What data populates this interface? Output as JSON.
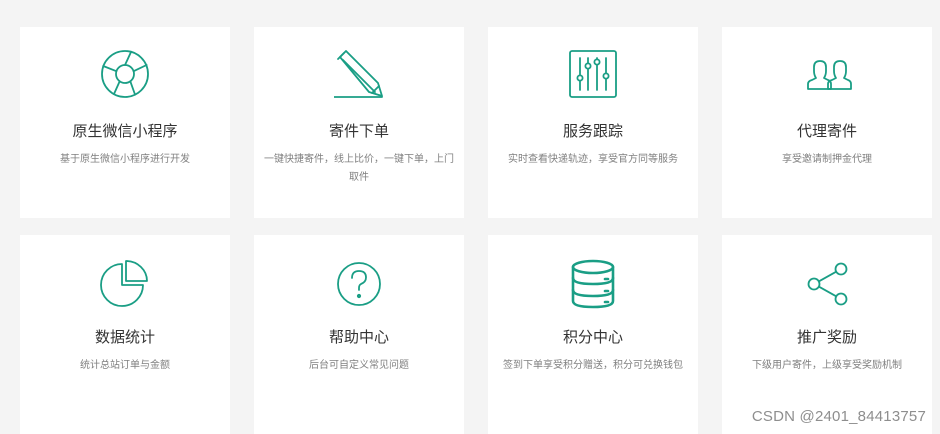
{
  "accent_color": "#1a9e85",
  "cards": [
    {
      "icon": "aperture-icon",
      "title": "原生微信小程序",
      "desc": "基于原生微信小程序进行开发"
    },
    {
      "icon": "pencil-icon",
      "title": "寄件下单",
      "desc": "一键快捷寄件，线上比价，一键下单，上门取件"
    },
    {
      "icon": "sliders-icon",
      "title": "服务跟踪",
      "desc": "实时查看快递轨迹，享受官方同等服务"
    },
    {
      "icon": "users-icon",
      "title": "代理寄件",
      "desc": "享受邀请制押金代理"
    },
    {
      "icon": "pie-chart-icon",
      "title": "数据统计",
      "desc": "统计总站订单与金额"
    },
    {
      "icon": "help-circle-icon",
      "title": "帮助中心",
      "desc": "后台可自定义常见问题"
    },
    {
      "icon": "database-icon",
      "title": "积分中心",
      "desc": "签到下单享受积分赠送，积分可兑换钱包"
    },
    {
      "icon": "share-icon",
      "title": "推广奖励",
      "desc": "下级用户寄件，上级享受奖励机制"
    }
  ],
  "watermark": "CSDN @2401_84413757"
}
